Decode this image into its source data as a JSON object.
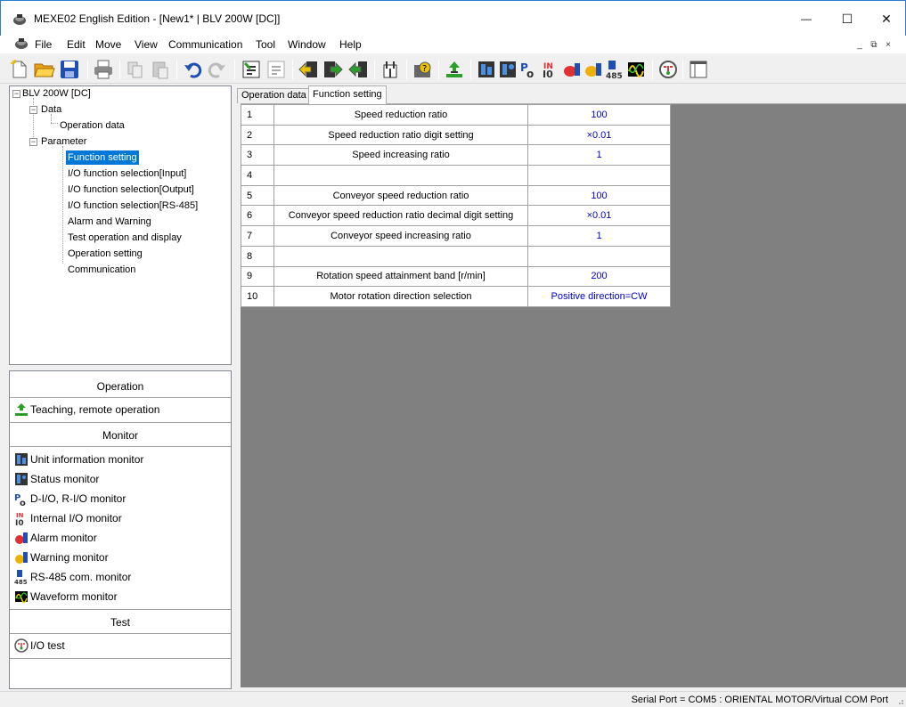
{
  "window": {
    "title": "MEXE02 English Edition - [New1* | BLV 200W [DC]]",
    "minimize": "—",
    "maximize": "☐",
    "close": "✕"
  },
  "menu": {
    "items": [
      "File",
      "Edit",
      "Move",
      "View",
      "Communication",
      "Tool",
      "Window",
      "Help"
    ],
    "mdi": [
      "_",
      "⧉",
      "×"
    ]
  },
  "tree": {
    "root": "BLV 200W [DC]",
    "data": "Data",
    "operation_data": "Operation data",
    "parameter": "Parameter",
    "children": [
      "Function setting",
      "I/O function selection[Input]",
      "I/O function selection[Output]",
      "I/O function selection[RS-485]",
      "Alarm and Warning",
      "Test operation and display",
      "Operation setting",
      "Communication"
    ],
    "selected": "Function setting"
  },
  "panel": {
    "operation_header": "Operation",
    "teaching": "Teaching, remote operation",
    "monitor_header": "Monitor",
    "monitors": [
      "Unit information monitor",
      "Status monitor",
      "D-I/O, R-I/O monitor",
      "Internal I/O monitor",
      "Alarm monitor",
      "Warning monitor",
      "RS-485 com. monitor",
      "Waveform monitor"
    ],
    "test_header": "Test",
    "io_test": "I/O test"
  },
  "tabs": [
    "Operation data",
    "Function setting"
  ],
  "active_tab": "Function setting",
  "grid": {
    "rows": [
      {
        "num": "1",
        "name": "Speed reduction ratio",
        "value": "100"
      },
      {
        "num": "2",
        "name": "Speed reduction ratio digit setting",
        "value": "×0.01"
      },
      {
        "num": "3",
        "name": "Speed increasing ratio",
        "value": "1"
      },
      {
        "num": "4",
        "name": "",
        "value": ""
      },
      {
        "num": "5",
        "name": "Conveyor speed reduction ratio",
        "value": "100"
      },
      {
        "num": "6",
        "name": "Conveyor speed reduction ratio decimal digit setting",
        "value": "×0.01"
      },
      {
        "num": "7",
        "name": "Conveyor speed increasing ratio",
        "value": "1"
      },
      {
        "num": "8",
        "name": "",
        "value": ""
      },
      {
        "num": "9",
        "name": "Rotation speed attainment band [r/min]",
        "value": "200"
      },
      {
        "num": "10",
        "name": "Motor rotation direction selection",
        "value": "Positive direction=CW"
      }
    ]
  },
  "status": {
    "text": "Serial Port = COM5 : ORIENTAL MOTOR/Virtual COM Port"
  },
  "colors": {
    "selection": "#0078d7",
    "value_text": "#0000cc",
    "grid_background": "#808080"
  }
}
